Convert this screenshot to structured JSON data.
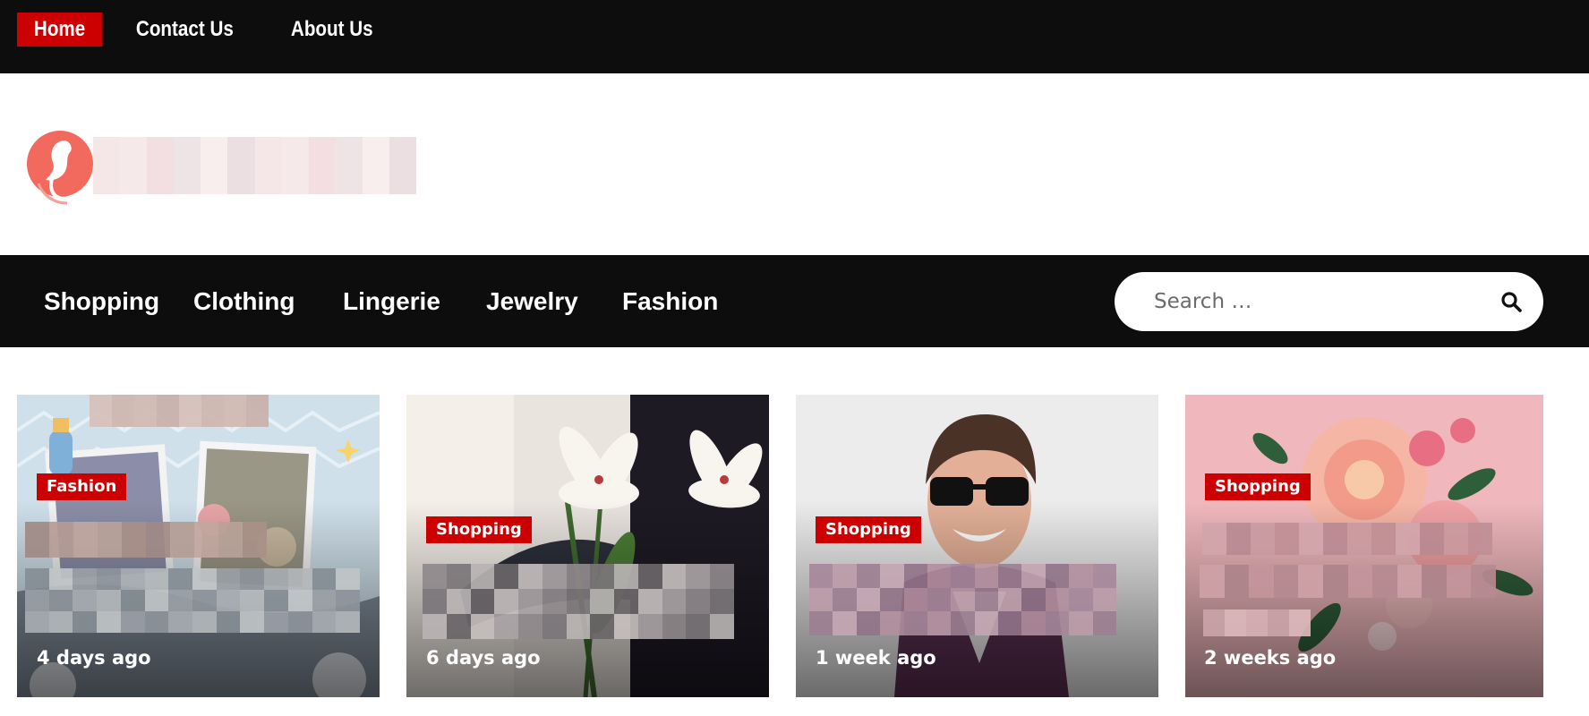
{
  "top_nav": {
    "items": [
      {
        "label": "Home",
        "active": true
      },
      {
        "label": "Contact Us",
        "active": false
      },
      {
        "label": "About Us",
        "active": false
      }
    ]
  },
  "category_nav": {
    "items": [
      {
        "label": "Shopping"
      },
      {
        "label": "Clothing"
      },
      {
        "label": "Lingerie"
      },
      {
        "label": "Jewelry"
      },
      {
        "label": "Fashion"
      }
    ]
  },
  "search": {
    "placeholder": "Search …",
    "icon": "search-icon"
  },
  "cards": [
    {
      "category": "Fashion",
      "time": "4 days ago",
      "image": "baby-gift-basket-photo"
    },
    {
      "category": "Shopping",
      "time": "6 days ago",
      "image": "white-lily-bouquet-photo"
    },
    {
      "category": "Shopping",
      "time": "1 week ago",
      "image": "man-in-sunglasses-photo"
    },
    {
      "category": "Shopping",
      "time": "2 weeks ago",
      "image": "pink-peony-flowers-photo"
    }
  ],
  "colors": {
    "bar_background": "#0d0d0d",
    "accent_red": "#cc0000",
    "text_white": "#ffffff"
  }
}
